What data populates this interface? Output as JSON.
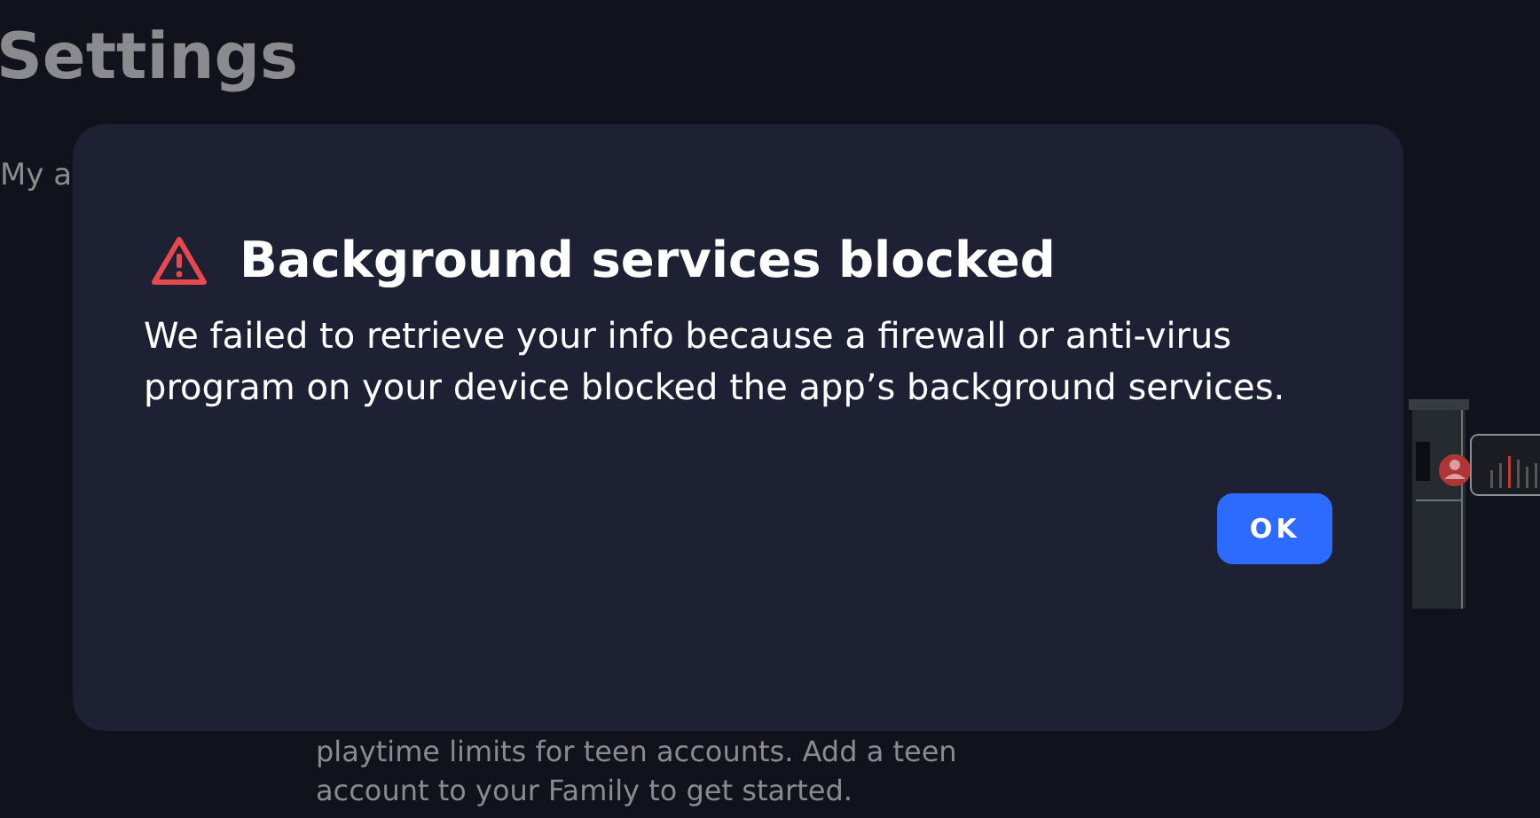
{
  "page": {
    "title": "Settings",
    "tab_partial": "My a",
    "description_lines": [
      "playtime limits for teen accounts. Add a teen",
      "account to your Family to get started."
    ]
  },
  "dialog": {
    "title": "Background services blocked",
    "message": "We failed to retrieve your info because a firewall or anti-virus program on your device blocked the app’s background services.",
    "buttons": [
      "OK"
    ]
  }
}
